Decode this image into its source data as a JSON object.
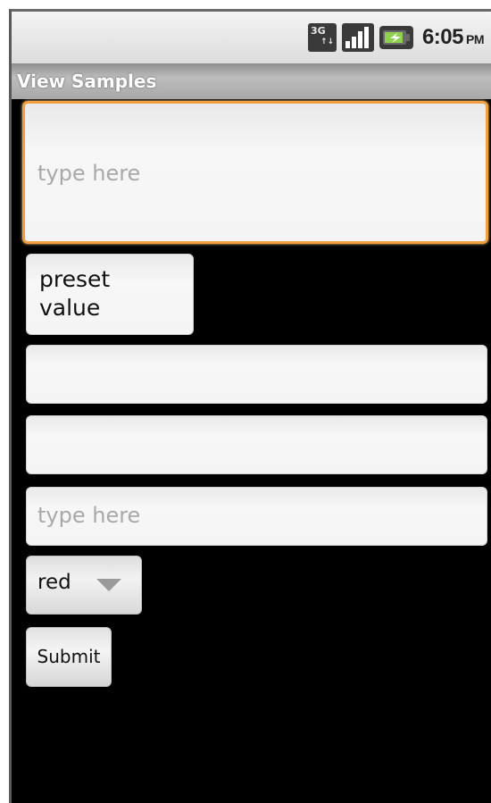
{
  "status_bar": {
    "network_icon": "3g-data-icon",
    "signal_icon": "signal-strength-icon",
    "battery_icon": "battery-icon",
    "time": "6:05",
    "ampm": "PM"
  },
  "app": {
    "title": "View Samples"
  },
  "form": {
    "multiline_field": {
      "placeholder": "type here",
      "value": ""
    },
    "preset_field": {
      "value": "preset value"
    },
    "empty_field_1": {
      "value": ""
    },
    "empty_field_2": {
      "value": ""
    },
    "hint_field": {
      "placeholder": "type here",
      "value": ""
    },
    "color_spinner": {
      "selected": "red"
    },
    "submit_label": "Submit"
  },
  "colors": {
    "focus_border": "#f0a040",
    "background": "#000000",
    "placeholder": "#a9a9a9"
  }
}
